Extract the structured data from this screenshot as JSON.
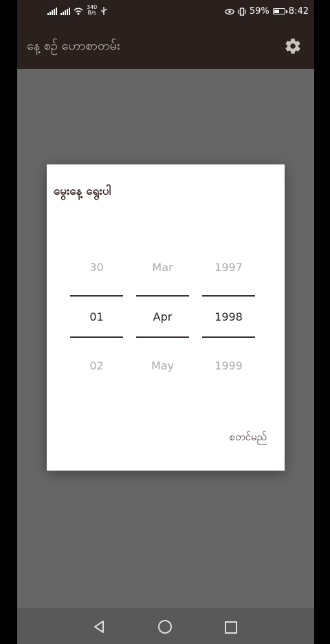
{
  "status_bar": {
    "net_speed_value": "340",
    "net_speed_unit": "B/s",
    "battery_percent": "59%",
    "time": "8:42",
    "battery_level": 0.59
  },
  "app_bar": {
    "title": "နေ့ စဉ် ဟောစာတမ်း",
    "settings_icon": "gear-icon"
  },
  "dialog": {
    "title": "မွေးနေ့ ရွေးပါ",
    "picker": {
      "day": {
        "prev": "30",
        "current": "01",
        "next": "02"
      },
      "month": {
        "prev": "Mar",
        "current": "Apr",
        "next": "May"
      },
      "year": {
        "prev": "1997",
        "current": "1998",
        "next": "1999"
      }
    },
    "confirm_label": "စတင်မည်"
  },
  "nav_bar": {
    "back_icon": "back-triangle-icon",
    "home_icon": "home-circle-icon",
    "recents_icon": "recents-square-icon"
  },
  "colors": {
    "app_bar_bg": "#2a211f",
    "scrim": "#666666",
    "divider": "#3b302d"
  }
}
